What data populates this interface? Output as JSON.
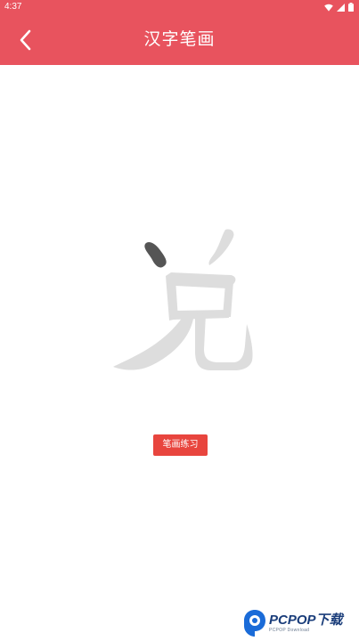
{
  "status_bar": {
    "time": "4:37",
    "icons": [
      "wifi-icon",
      "signal-icon",
      "battery-icon"
    ]
  },
  "app_bar": {
    "title": "汉字笔画",
    "back_icon": "chevron-left-icon"
  },
  "character": {
    "glyph": "兑",
    "highlighted_stroke": 1
  },
  "practice_button": {
    "label": "笔画练习"
  },
  "watermark": {
    "title": "PCPOP下载",
    "subtitle": "PCPOP Download"
  },
  "colors": {
    "header": "#e8535e",
    "button": "#e8453e",
    "glyph": "#dddddd",
    "stroke_highlight": "#555555"
  }
}
